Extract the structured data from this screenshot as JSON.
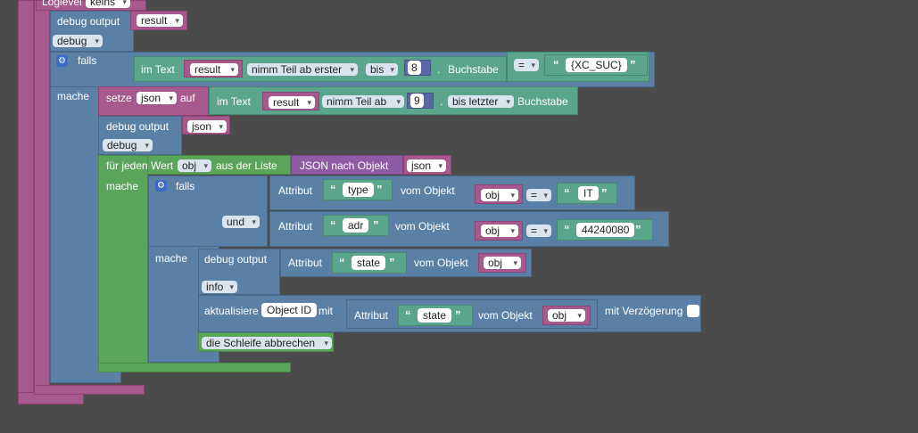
{
  "loglevel": {
    "label": "Loglevel",
    "value": "keins"
  },
  "debug1": {
    "label": "debug output",
    "var": "result",
    "level": "debug"
  },
  "if1": {
    "falls": "falls",
    "mache": "mache",
    "im_text": "im Text",
    "var": "result",
    "mode": "nimm Teil ab erster",
    "bis": "bis",
    "num": "8",
    "dot": ".",
    "buchstabe": "Buchstabe",
    "op": "=",
    "text": "{XC_SUC}"
  },
  "set1": {
    "setze": "setze",
    "var": "json",
    "auf": "auf",
    "im_text": "im Text",
    "src": "result",
    "mode": "nimm Teil ab",
    "num": "9",
    "dot": ".",
    "end_mode": "bis letzter",
    "buchstabe": "Buchstabe"
  },
  "debug2": {
    "label": "debug output",
    "var": "json",
    "level": "debug"
  },
  "foreach": {
    "label": "für jeden Wert",
    "var": "obj",
    "aus": "aus der Liste",
    "json_obj": "JSON nach Objekt",
    "src": "json",
    "mache": "mache"
  },
  "if2": {
    "falls": "falls",
    "mache": "mache",
    "und": "und",
    "attr1": {
      "label": "Attribut",
      "key": "type",
      "vom": "vom Objekt",
      "obj": "obj",
      "op": "=",
      "text": "IT"
    },
    "attr2": {
      "label": "Attribut",
      "key": "adr",
      "vom": "vom Objekt",
      "obj": "obj",
      "op": "=",
      "text": "44240080"
    }
  },
  "debug3": {
    "label": "debug output",
    "attr": "Attribut",
    "key": "state",
    "vom": "vom Objekt",
    "obj": "obj",
    "level": "info"
  },
  "update": {
    "label": "aktualisiere",
    "field": "Object ID",
    "mit": "mit",
    "attr": "Attribut",
    "key": "state",
    "vom": "vom Objekt",
    "obj": "obj",
    "delay": "mit Verzögerung",
    "delay_checked": false
  },
  "break": {
    "label": "die Schleife abbrechen"
  },
  "colors": {
    "purple": "#a5598c",
    "blue": "#5b80a5",
    "green": "#5ba55b",
    "teal": "#5ba58c",
    "violet": "#8f5ba5",
    "number": "#5b67a5",
    "background": "#4b4b4b"
  }
}
